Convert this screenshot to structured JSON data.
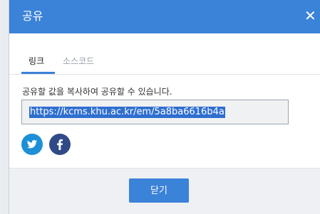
{
  "dialog": {
    "title": "공유",
    "close_glyph": "✕"
  },
  "tabs": [
    {
      "label": "링크",
      "active": true
    },
    {
      "label": "소스코드",
      "active": false
    }
  ],
  "link": {
    "description": "공유할 값을 복사하여 공유할 수 있습니다.",
    "url": "https://kcms.khu.ac.kr/em/5a8ba6616b4a"
  },
  "social": {
    "twitter_icon": "twitter-icon",
    "facebook_icon": "facebook-icon",
    "twitter_color": "#1d8fd6",
    "facebook_color": "#2f4a86"
  },
  "footer": {
    "close_label": "닫기"
  },
  "colors": {
    "accent": "#3b82d9"
  }
}
